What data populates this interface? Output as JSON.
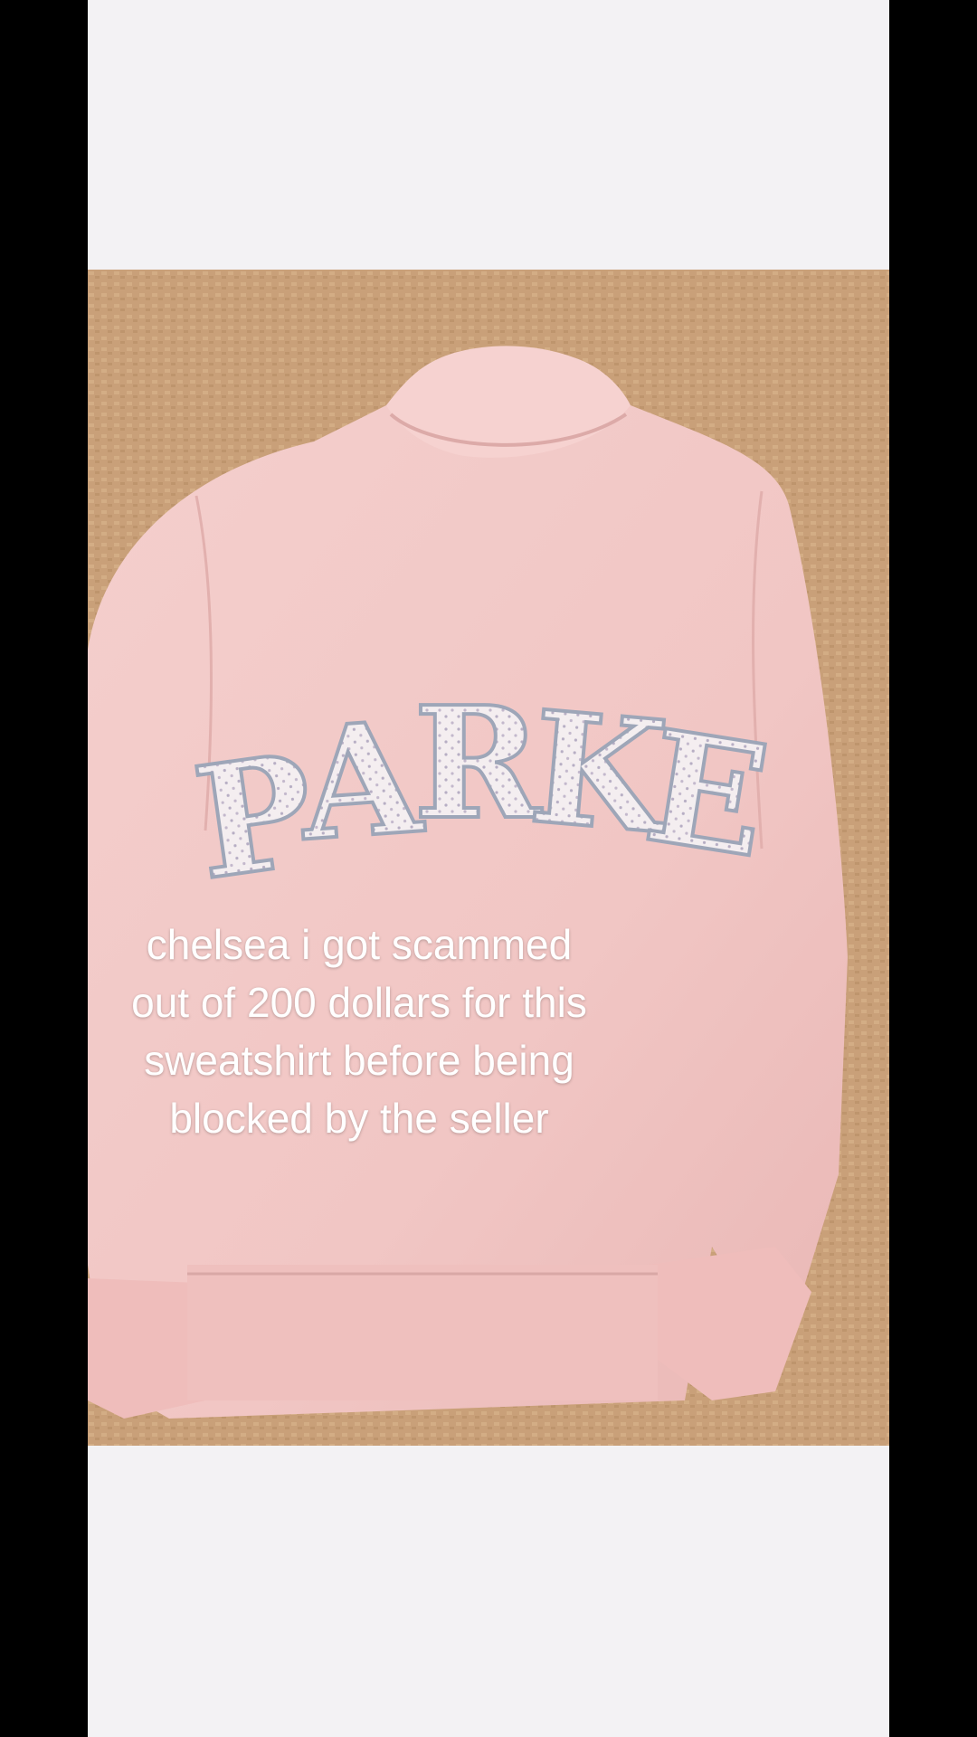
{
  "caption": {
    "lines": [
      "chelsea i got scammed",
      "out of 200 dollars for this",
      "sweatshirt before being",
      "blocked by the seller"
    ]
  },
  "photo": {
    "subject": "pink-mock-neck-sweatshirt",
    "print_text": "PARKE",
    "colors": {
      "rug": "#c9a079",
      "sweatshirt": "#f2c8c6",
      "letters": "#f4eef0",
      "frame": "#f3f2f4",
      "side_bars": "#000000"
    }
  }
}
